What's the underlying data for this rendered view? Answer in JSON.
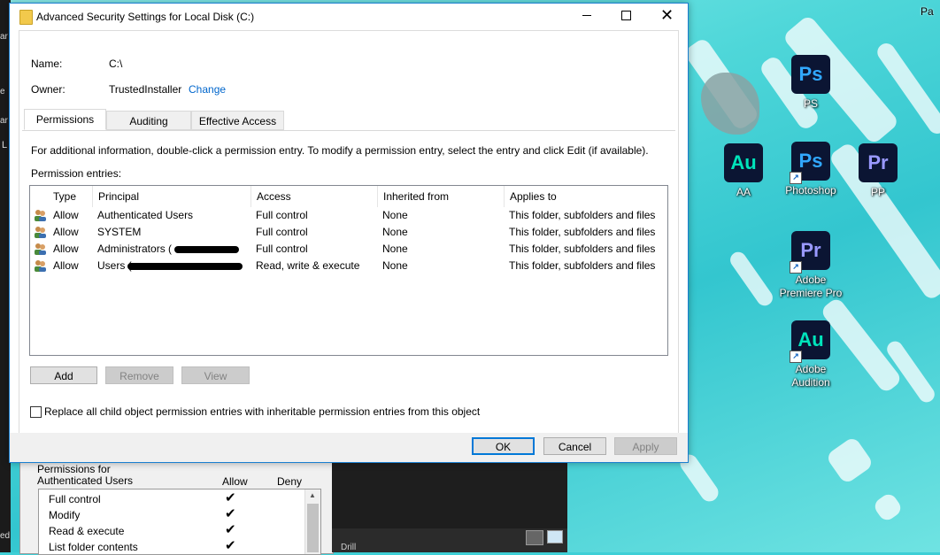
{
  "window": {
    "title": "Advanced Security Settings for Local Disk (C:)",
    "name_label": "Name:",
    "name_value": "C:\\",
    "owner_label": "Owner:",
    "owner_value": "TrustedInstaller",
    "owner_change": "Change"
  },
  "tabs": [
    {
      "label": "Permissions",
      "active": true
    },
    {
      "label": "Auditing",
      "active": false
    },
    {
      "label": "Effective Access",
      "active": false
    }
  ],
  "permissions": {
    "info_text": "For additional information, double-click a permission entry. To modify a permission entry, select the entry and click Edit (if available).",
    "entries_label": "Permission entries:",
    "columns": [
      "Type",
      "Principal",
      "Access",
      "Inherited from",
      "Applies to"
    ],
    "rows": [
      {
        "type": "Allow",
        "principal": "Authenticated Users",
        "access": "Full control",
        "inherited": "None",
        "applies": "This folder, subfolders and files"
      },
      {
        "type": "Allow",
        "principal": "SYSTEM",
        "access": "Full control",
        "inherited": "None",
        "applies": "This folder, subfolders and files"
      },
      {
        "type": "Allow",
        "principal": "Administrators (",
        "access": "Full control",
        "inherited": "None",
        "applies": "This folder, subfolders and files"
      },
      {
        "type": "Allow",
        "principal": "Users (",
        "access": "Read, write & execute",
        "inherited": "None",
        "applies": "This folder, subfolders and files"
      }
    ],
    "add": "Add",
    "remove": "Remove",
    "view": "View",
    "replace_checkbox": "Replace all child object permission entries with inheritable permission entries from this object"
  },
  "footer": {
    "ok": "OK",
    "cancel": "Cancel",
    "apply": "Apply"
  },
  "background_dialog": {
    "header": "Permissions for Authenticated Users",
    "allow": "Allow",
    "deny": "Deny",
    "items": [
      "Full control",
      "Modify",
      "Read & execute",
      "List folder contents"
    ]
  },
  "left_fragments": [
    "ar",
    "e",
    "ar",
    "L",
    "ed"
  ],
  "desktop_icons": [
    {
      "tile": "Ps",
      "label": "PS"
    },
    {
      "tile": "Au",
      "label": "AA"
    },
    {
      "tile": "Ps",
      "label": "Photoshop"
    },
    {
      "tile": "Pr",
      "label": "PP"
    },
    {
      "tile": "Pr",
      "label": "Adobe Premiere Pro"
    },
    {
      "tile": "Au",
      "label": "Adobe Audition"
    }
  ],
  "desktop_fragments": [
    "Pa",
    "Drill"
  ],
  "colors": {
    "ps": "#31a8ff",
    "au": "#00e4bb",
    "pr": "#9999ff",
    "link": "#0066cc",
    "accent": "#0078d7"
  }
}
